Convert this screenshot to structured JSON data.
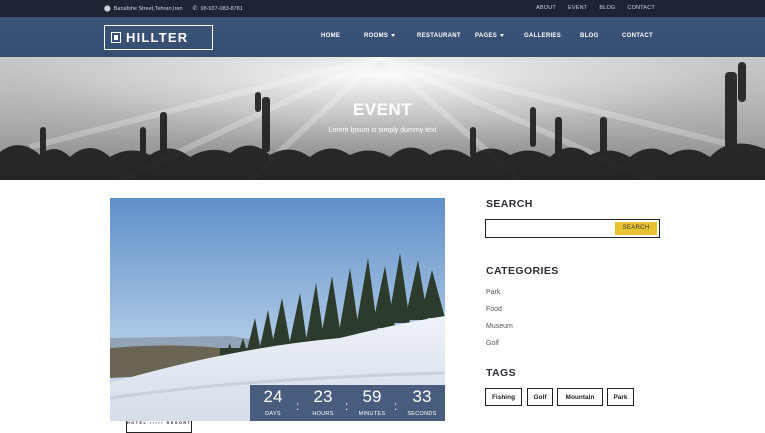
{
  "topbar": {
    "address": "Banafshe Street,Tehran,Iran",
    "phone": "98-937-083-8781",
    "links": [
      "ABOUT",
      "EVENT",
      "BLOG",
      "CONTACT"
    ]
  },
  "header": {
    "logo_brand": "HILLTER",
    "logo_tag": "HOTEL ▪▪▪▪▪ RESORT",
    "menu": [
      "HOME",
      "ROOMS",
      "RESTAURANT",
      "PAGES",
      "GALLERIES",
      "BLOG",
      "CONTACT"
    ]
  },
  "hero": {
    "title": "EVENT",
    "subtitle": "Lorem Ipsum is simply dummy text"
  },
  "countdown": [
    {
      "value": "24",
      "label": "DAYS"
    },
    {
      "value": "23",
      "label": "HOURS"
    },
    {
      "value": "59",
      "label": "MINUTES"
    },
    {
      "value": "33",
      "label": "SECONDS"
    }
  ],
  "sidebar": {
    "search_title": "SEARCH",
    "search_button": "SEARCH",
    "search_value": "",
    "categories_title": "CATEGORIES",
    "categories": [
      "Park",
      "Food",
      "Museum",
      "Golf"
    ],
    "tags_title": "TAGS",
    "tags": [
      "Fishing",
      "Golf",
      "Mountain",
      "Park"
    ]
  },
  "colors": {
    "nav": "#3c5479",
    "topbar": "#1f2433",
    "accent": "#e8c230"
  }
}
